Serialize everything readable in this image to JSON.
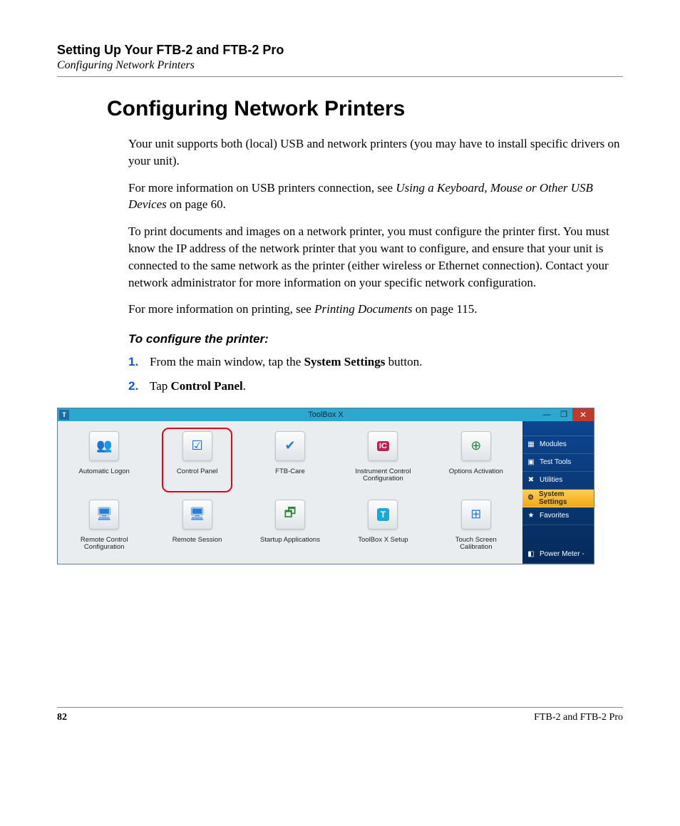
{
  "header": {
    "chapter": "Setting Up Your FTB-2 and FTB-2 Pro",
    "breadcrumb": "Configuring Network Printers"
  },
  "title": "Configuring Network Printers",
  "paragraphs": {
    "p1": "Your unit supports both (local) USB and network printers (you may have to install specific drivers on your unit).",
    "p2a": "For more information on USB printers connection, see ",
    "p2i": "Using a Keyboard, Mouse or Other USB Devices",
    "p2b": " on page 60.",
    "p3": "To print documents and images on a network printer, you must configure the printer first. You must know the IP address of the network printer that you want to configure, and ensure that your unit is connected to the same network as the printer (either wireless or Ethernet connection). Contact your network administrator for more information on your specific network configuration.",
    "p4a": "For more information on printing, see ",
    "p4i": "Printing Documents",
    "p4b": " on page 115."
  },
  "subhead": "To configure the printer:",
  "steps": [
    {
      "num": "1.",
      "a": "From the main window, tap the ",
      "bold": "System Settings",
      "b": " button."
    },
    {
      "num": "2.",
      "a": "Tap ",
      "bold": "Control Panel",
      "b": "."
    }
  ],
  "screenshot": {
    "title": "ToolBox X",
    "t_icon": "T",
    "tiles": [
      {
        "label": "Automatic Logon",
        "glyph": "g-users",
        "sym": "👥"
      },
      {
        "label": "Control Panel",
        "glyph": "g-ctrl",
        "sym": "☑",
        "highlight": true
      },
      {
        "label": "FTB-Care",
        "glyph": "g-care",
        "sym": "✔"
      },
      {
        "label": "Instrument Control Configuration",
        "glyph": "g-ic",
        "sym": "IC"
      },
      {
        "label": "Options Activation",
        "glyph": "g-plus",
        "sym": "⊕"
      },
      {
        "label": "Remote Control Configuration",
        "glyph": "g-rc",
        "sym": "🖥"
      },
      {
        "label": "Remote Session",
        "glyph": "g-rs",
        "sym": "🖥"
      },
      {
        "label": "Startup Applications",
        "glyph": "g-su",
        "sym": "🗗"
      },
      {
        "label": "ToolBox X Setup",
        "glyph": "g-tx",
        "sym": "T"
      },
      {
        "label": "Touch Screen Calibration",
        "glyph": "g-touch",
        "sym": "⊞"
      }
    ],
    "sidebar": [
      {
        "label": "Modules",
        "ico": "▦",
        "selected": false
      },
      {
        "label": "Test Tools",
        "ico": "▣",
        "selected": false
      },
      {
        "label": "Utilities",
        "ico": "✖",
        "selected": false
      },
      {
        "label": "System Settings",
        "ico": "⚙",
        "selected": true
      },
      {
        "label": "Favorites",
        "ico": "★",
        "selected": false
      },
      {
        "label": "Power Meter -",
        "ico": "◧",
        "selected": false,
        "bottom": true
      }
    ],
    "winbuttons": {
      "min": "—",
      "max": "❐",
      "close": "✕"
    }
  },
  "footer": {
    "page": "82",
    "right": "FTB-2 and FTB-2 Pro"
  }
}
